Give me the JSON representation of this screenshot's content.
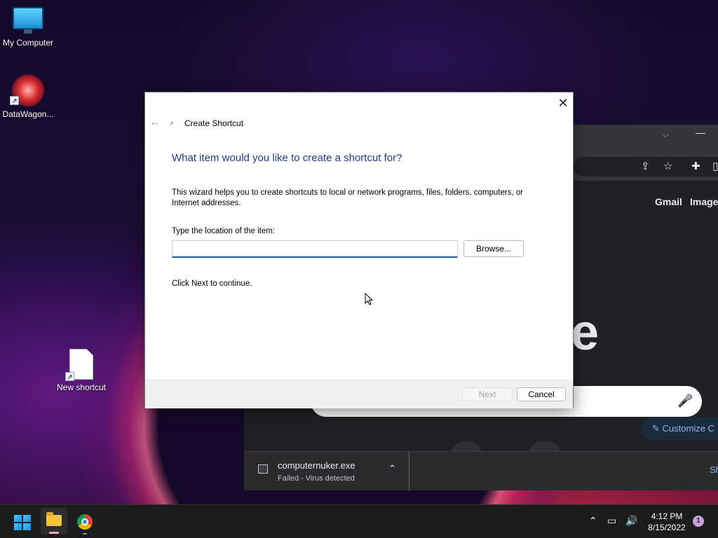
{
  "desktop": {
    "icons": [
      {
        "label": "My Computer"
      },
      {
        "label": "DataWagon..."
      },
      {
        "label": "New shortcut"
      }
    ]
  },
  "browser": {
    "links": {
      "gmail": "Gmail",
      "images": "Images"
    },
    "logo_fragment": "e",
    "customize_label": "Customize C",
    "download": {
      "filename": "computernuker.exe",
      "status": "Failed - Virus detected",
      "show_all_fragment": "Sh"
    }
  },
  "dialog": {
    "window_title": "Create Shortcut",
    "heading": "What item would you like to create a shortcut for?",
    "description": "This wizard helps you to create shortcuts to local or network programs, files, folders, computers, or Internet addresses.",
    "location_label": "Type the location of the item:",
    "location_value": "",
    "browse_label": "Browse...",
    "continue_text": "Click Next to continue.",
    "next_label": "Next",
    "cancel_label": "Cancel"
  },
  "taskbar": {
    "time": "4:12 PM",
    "date": "8/15/2022",
    "notification_count": "1"
  },
  "colors": {
    "heading_blue": "#1f3a8f",
    "input_underline": "#1f5aa8",
    "taskbar_bg": "#1c1c1c"
  }
}
